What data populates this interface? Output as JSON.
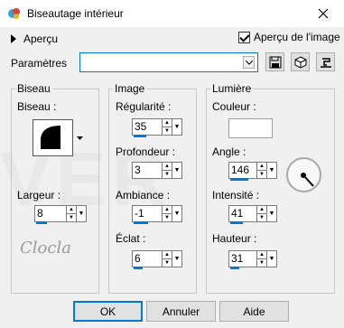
{
  "window": {
    "title": "Biseautage intérieur",
    "app_icon": "psp-icon",
    "close_icon": "close-icon"
  },
  "preview": {
    "label": "Aperçu",
    "image_preview_label": "Aperçu de l'image",
    "image_preview_checked": true
  },
  "presets": {
    "label": "Paramètres",
    "value": ""
  },
  "bevel_group": {
    "title": "Biseau",
    "bevel_label": "Biseau :",
    "width_label": "Largeur :",
    "width_value": "8"
  },
  "image_group": {
    "title": "Image",
    "smoothness_label": "Régularité :",
    "smoothness_value": "35",
    "depth_label": "Profondeur :",
    "depth_value": "3",
    "ambience_label": "Ambiance :",
    "ambience_value": "-1",
    "shininess_label": "Éclat :",
    "shininess_value": "6"
  },
  "light_group": {
    "title": "Lumière",
    "color_label": "Couleur :",
    "color_value": "#ffffff",
    "angle_label": "Angle :",
    "angle_value": "146",
    "intensity_label": "Intensité :",
    "intensity_value": "41",
    "elevation_label": "Hauteur :",
    "elevation_value": "31"
  },
  "watermark": {
    "text": "VER",
    "logo_text": "Clocla"
  },
  "buttons": {
    "ok": "OK",
    "cancel": "Annuler",
    "help": "Aide"
  }
}
